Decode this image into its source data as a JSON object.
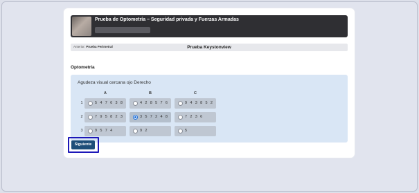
{
  "banner": {
    "title": "Prueba de Optometría – Seguridad privada y Fuerzas Armadas"
  },
  "nav": {
    "previous_prefix": "Anterior:",
    "previous_name": "Prueba Perimetral",
    "current": "Prueba Keystonview"
  },
  "section": {
    "title": "Optometría"
  },
  "question": {
    "text": "Agudeza visual cercana ojo Derecho",
    "columns": [
      "A",
      "B",
      "C"
    ],
    "rows": [
      "1",
      "2",
      "3"
    ],
    "options": [
      [
        "5 4 7 6 3 8",
        "4 2 8 5 7 6",
        "9 4 3 8 5 2"
      ],
      [
        "7 9 5 8 2 3",
        "3 5 7 2 4 8",
        "7 2 3 6"
      ],
      [
        "9 5 7 4",
        "9 2",
        "5"
      ]
    ],
    "selected": {
      "row": 2,
      "column": "B"
    }
  },
  "actions": {
    "next_label": "Siguiente"
  }
}
